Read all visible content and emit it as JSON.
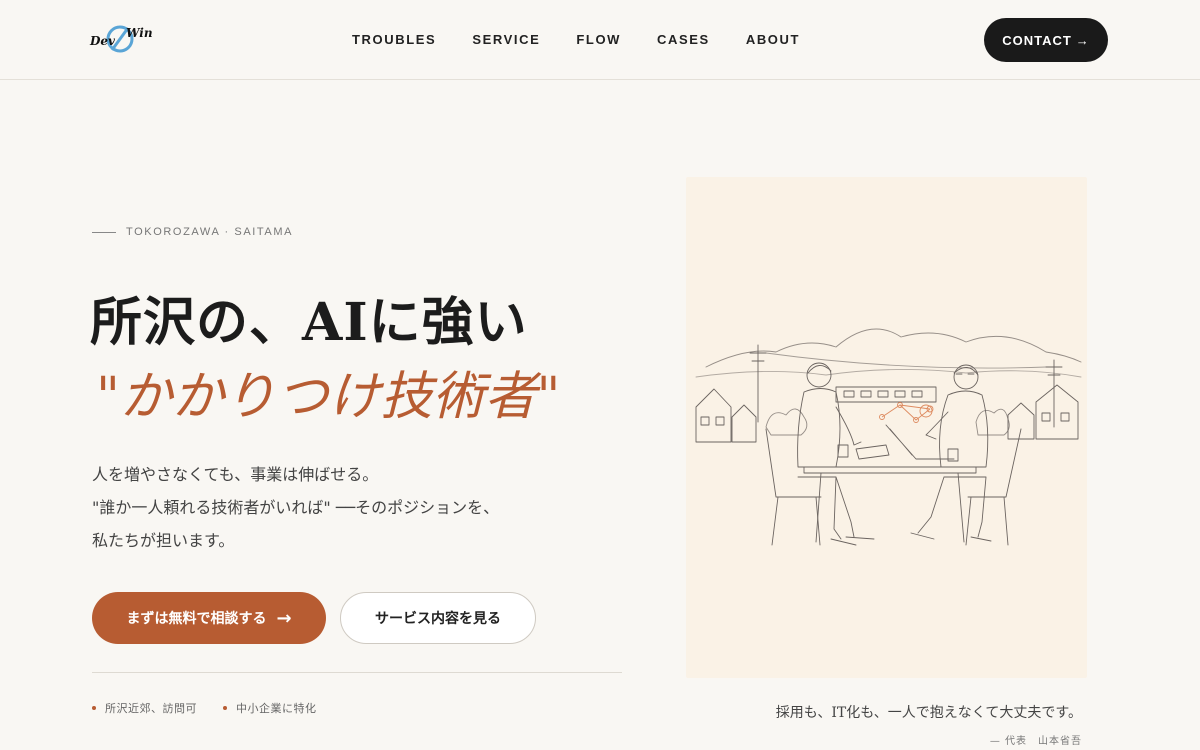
{
  "header": {
    "logo_left": "Dev",
    "logo_right": "Win",
    "nav": [
      "TROUBLES",
      "SERVICE",
      "FLOW",
      "CASES",
      "ABOUT"
    ],
    "contact_label": "CONTACT",
    "contact_arrow": "→"
  },
  "hero": {
    "eyebrow": "TOKOROZAWA · SAITAMA",
    "headline_line1": "所沢の、AIに強い",
    "headline_line2": "\"かかりつけ技術者\"",
    "lead": [
      "人を増やさなくても、事業は伸ばせる。",
      "\"誰か一人頼れる技術者がいれば\" ──そのポジションを、",
      "私たちが担います。"
    ],
    "primary_cta": "まずは無料で相談する",
    "primary_arrow": "→",
    "secondary_cta": "サービス内容を見る",
    "bullets": [
      "所沢近郊、訪問可",
      "中小企業に特化"
    ]
  },
  "illustration": {
    "quote": "採用も、IT化も、一人で抱えなくて大丈夫です。",
    "attribution": "— 代表　山本省吾"
  },
  "colors": {
    "accent": "#b75c32",
    "dark": "#1a1a1a",
    "background": "#f9f7f3"
  }
}
